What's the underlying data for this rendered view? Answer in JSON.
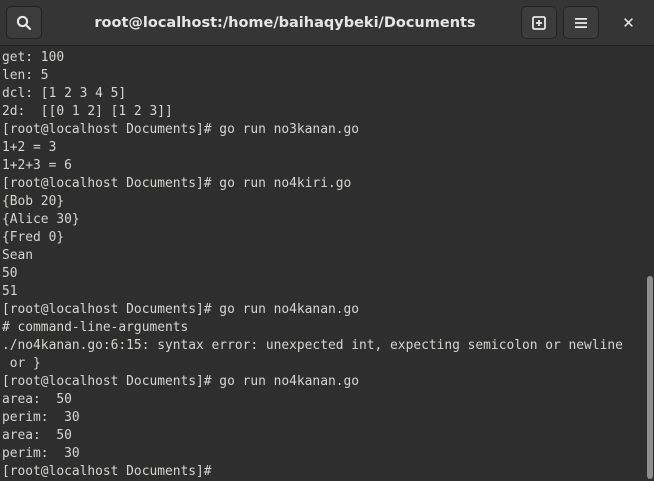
{
  "window": {
    "title": "root@localhost:/home/baihaqybeki/Documents",
    "close_glyph": "✕"
  },
  "icons": {
    "search": "search-icon",
    "new_tab": "new-tab-icon",
    "menu": "hamburger-menu-icon",
    "close": "close-icon"
  },
  "terminal": {
    "lines": [
      "get: 100",
      "len: 5",
      "dcl: [1 2 3 4 5]",
      "2d:  [[0 1 2] [1 2 3]]",
      "[root@localhost Documents]# go run no3kanan.go",
      "1+2 = 3",
      "1+2+3 = 6",
      "[root@localhost Documents]# go run no4kiri.go",
      "{Bob 20}",
      "{Alice 30}",
      "{Fred 0}",
      "Sean",
      "50",
      "51",
      "[root@localhost Documents]# go run no4kanan.go",
      "# command-line-arguments",
      "./no4kanan.go:6:15: syntax error: unexpected int, expecting semicolon or newline",
      " or }",
      "[root@localhost Documents]# go run no4kanan.go",
      "area:  50",
      "perim:  30",
      "area:  50",
      "perim:  30",
      "[root@localhost Documents]#"
    ]
  },
  "colors": {
    "titlebar_bg": "#353535",
    "terminal_bg": "#2e2e2e",
    "terminal_fg": "#d3d7cf",
    "scrollbar_thumb": "#8d8d8d"
  }
}
